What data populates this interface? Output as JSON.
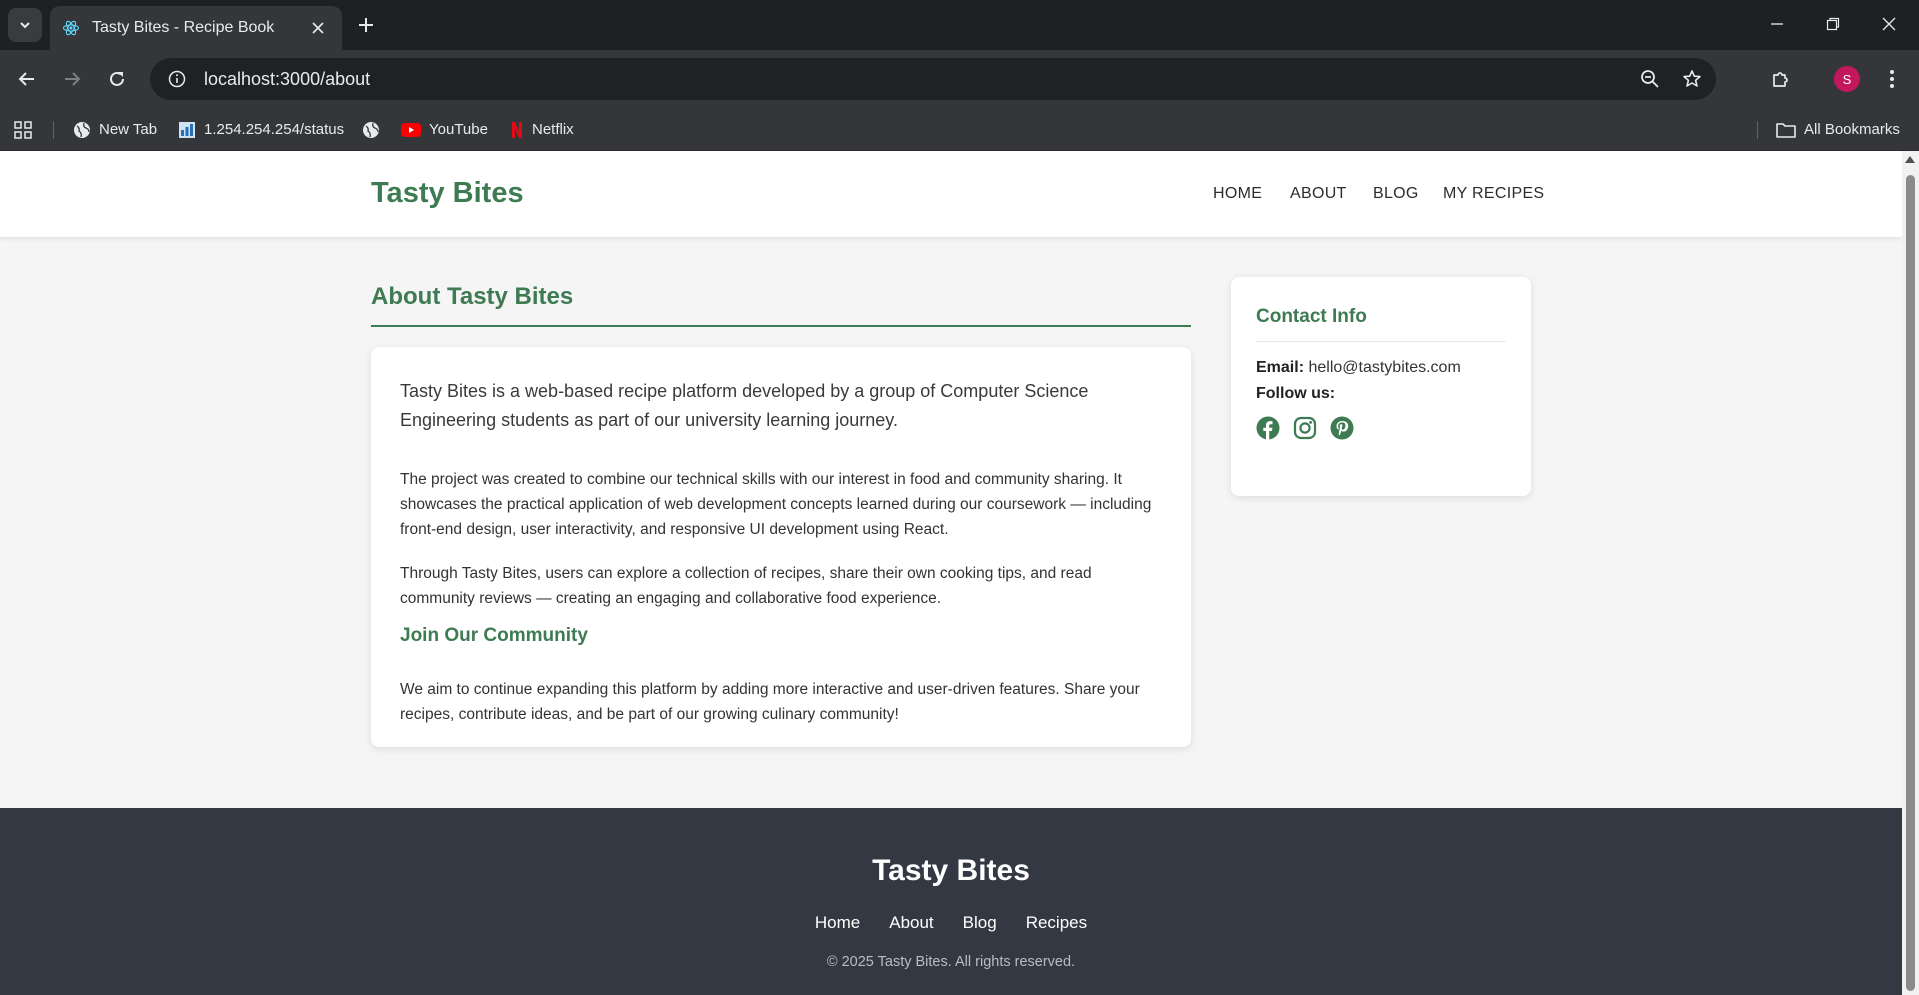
{
  "browser": {
    "tab_title": "Tasty Bites - Recipe Book",
    "url": "localhost:3000/about",
    "bookmarks": [
      {
        "label": "New Tab",
        "icon": "globe-icon"
      },
      {
        "label": "1.254.254.254/status",
        "icon": "status-page-icon"
      },
      {
        "label": "",
        "icon": "globe-icon"
      },
      {
        "label": "YouTube",
        "icon": "youtube-icon"
      },
      {
        "label": "Netflix",
        "icon": "netflix-icon"
      }
    ],
    "all_bookmarks": "All Bookmarks",
    "profile_initial": "S",
    "colors": {
      "chrome_dark": "#1f2023",
      "toolbar": "#35363a",
      "profile": "#c2185b"
    }
  },
  "site": {
    "logo": "Tasty Bites",
    "nav": [
      "HOME",
      "ABOUT",
      "BLOG",
      "MY RECIPES"
    ],
    "accent_color": "#3e7a52"
  },
  "about": {
    "title": "About Tasty Bites",
    "lead": "Tasty Bites is a web-based recipe platform developed by a group of Computer Science Engineering students as part of our university learning journey.",
    "para1": "The project was created to combine our technical skills with our interest in food and community sharing. It showcases the practical application of web development concepts learned during our coursework — including front-end design, user interactivity, and responsive UI development using React.",
    "para2": "Through Tasty Bites, users can explore a collection of recipes, share their own cooking tips, and read community reviews — creating an engaging and collaborative food experience.",
    "community_heading": "Join Our Community",
    "para3": "We aim to continue expanding this platform by adding more interactive and user-driven features. Share your recipes, contribute ideas, and be part of our growing culinary community!"
  },
  "contact": {
    "title": "Contact Info",
    "email_label": "Email:",
    "email": "hello@tastybites.com",
    "follow_label": "Follow us:",
    "socials": [
      "facebook-icon",
      "instagram-icon",
      "pinterest-icon"
    ]
  },
  "footer": {
    "logo": "Tasty Bites",
    "links": [
      "Home",
      "About",
      "Blog",
      "Recipes"
    ],
    "copyright": "© 2025 Tasty Bites. All rights reserved.",
    "bg_color": "#343842"
  }
}
